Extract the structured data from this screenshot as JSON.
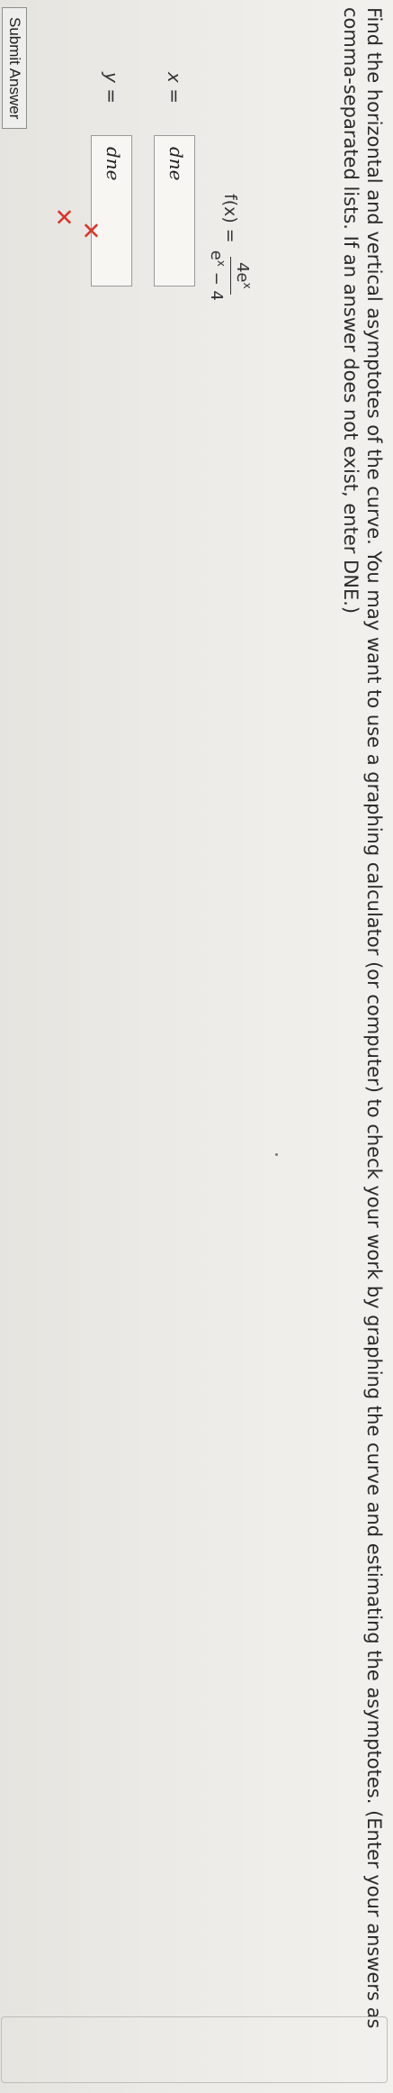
{
  "question": {
    "text": "Find the horizontal and vertical asymptotes of the curve. You may want to use a graphing calculator (or computer) to check your work by graphing the curve and estimating the asymptotes. (Enter your answers as comma-separated lists. If an answer does not exist, enter DNE.)"
  },
  "formula": {
    "lhs": "f(x) =",
    "numerator": "4e",
    "numerator_exp": "x",
    "denominator_base": "e",
    "denominator_exp": "x",
    "denominator_rest": " − 4"
  },
  "answers": {
    "x": {
      "label_var": "x",
      "label_eq": " =",
      "value": "dne",
      "status": "incorrect"
    },
    "y": {
      "label_var": "y",
      "label_eq": " =",
      "value": "dne",
      "status": "incorrect"
    }
  },
  "marks": {
    "incorrect_symbol": "✕",
    "color": "#d9342b"
  },
  "submit": {
    "label": "Submit Answer"
  }
}
